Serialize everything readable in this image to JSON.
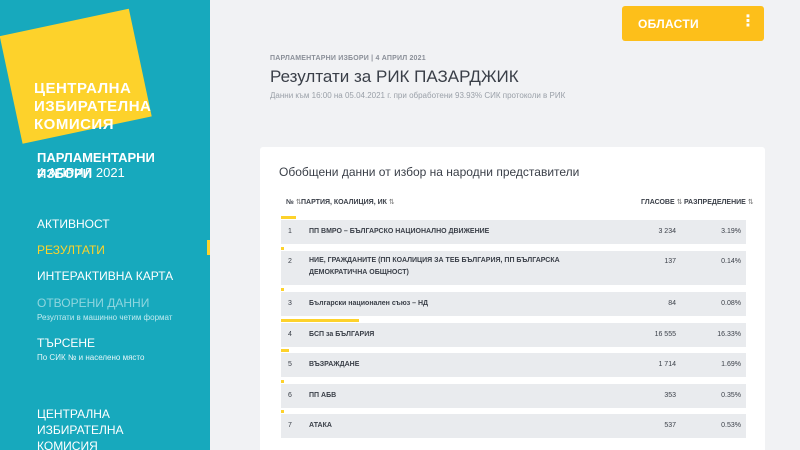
{
  "sidebar": {
    "logo_lines": [
      "ЦЕНТРАЛНА",
      "ИЗБИРАТЕЛНА",
      "КОМИСИЯ"
    ],
    "election_title": "ПАРЛАМЕНТАРНИ ИЗБОРИ",
    "election_date": "4 АПРИЛ 2021",
    "nav": [
      {
        "label": "АКТИВНОСТ"
      },
      {
        "label": "РЕЗУЛТАТИ"
      },
      {
        "label": "ИНТЕРАКТИВНА КАРТА"
      },
      {
        "label": "ОТВОРЕНИ ДАННИ",
        "sub": "Резултати в машинно четим формат"
      },
      {
        "label": "ТЪРСЕНЕ",
        "sub": "По СИК № и населено място"
      }
    ],
    "footer": "ЦЕНТРАЛНА ИЗБИРАТЕЛНА КОМИСИЯ",
    "accent_color": "#fdd22b",
    "background_color": "#17a9bd"
  },
  "header": {
    "regions_button": "ОБЛАСТИ",
    "menu_icon": "kebab-menu-icon",
    "breadcrumb": "ПАРЛАМЕНТАРНИ ИЗБОРИ | 4 АПРИЛ 2021",
    "title": "Резултати за РИК ПАЗАРДЖИК",
    "subtitle": "Данни към 16:00 на 05.04.2021 г. при обработени 93.93% СИК протоколи в РИК"
  },
  "table": {
    "title": "Обобщени данни от избор на народни представители",
    "columns": {
      "num": "№",
      "party": "ПАРТИЯ, КОАЛИЦИЯ, ИК",
      "votes": "ГЛАСОВЕ",
      "share": "РАЗПРЕДЕЛЕНИЕ"
    },
    "sort_icon": "sort-arrows-icon",
    "rows": [
      {
        "num": "1",
        "party": "ПП ВМРО – БЪЛГАРСКО НАЦИОНАЛНО ДВИЖЕНИЕ",
        "votes": "3 234",
        "share": "3.19%",
        "share_value": 3.19
      },
      {
        "num": "2",
        "party": "НИЕ, ГРАЖДАНИТЕ (ПП КОАЛИЦИЯ ЗА ТЕБ БЪЛГАРИЯ, ПП БЪЛГАРСКА ДЕМОКРАТИЧНА ОБЩНОСТ)",
        "votes": "137",
        "share": "0.14%",
        "share_value": 0.14
      },
      {
        "num": "3",
        "party": "Български национален съюз – НД",
        "votes": "84",
        "share": "0.08%",
        "share_value": 0.08
      },
      {
        "num": "4",
        "party": "БСП за БЪЛГАРИЯ",
        "votes": "16 555",
        "share": "16.33%",
        "share_value": 16.33
      },
      {
        "num": "5",
        "party": "ВЪЗРАЖДАНЕ",
        "votes": "1 714",
        "share": "1.69%",
        "share_value": 1.69
      },
      {
        "num": "6",
        "party": "ПП АБВ",
        "votes": "353",
        "share": "0.35%",
        "share_value": 0.35
      },
      {
        "num": "7",
        "party": "АТАКА",
        "votes": "537",
        "share": "0.53%",
        "share_value": 0.53
      }
    ]
  }
}
